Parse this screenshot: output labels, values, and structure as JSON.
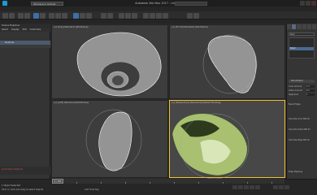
{
  "window": {
    "title": "Autodesk 3ds Max 2017 - Untitled",
    "workspace": "Workspace: Default"
  },
  "left_panel": {
    "title": "Scene Explorer",
    "tabs": [
      "Select",
      "Display",
      "Edit",
      "Customize"
    ],
    "selected_item": "Sinkhole"
  },
  "viewports": [
    {
      "label": "[+] [Top] [Standard] [Wireframe]"
    },
    {
      "label": "[+] [Front] [Standard] [Wireframe]"
    },
    {
      "label": "[+] [Left] [Standard] [Wireframe]"
    },
    {
      "label": "[+] [Perspective] [Standard] [Default Shading]"
    }
  ],
  "right_panel": {
    "object_name": "Sink",
    "selected_modifier": "Shell",
    "rollout": "Parameters",
    "params": [
      {
        "label": "Inner Amount",
        "value": "1.0"
      },
      {
        "label": "Outer Amount",
        "value": "0.0"
      },
      {
        "label": "Segments",
        "value": "1"
      }
    ],
    "bevel_label": "Bevel Edges",
    "override_rows": [
      "Override Inner Mat ID",
      "Override Outer Mat ID",
      "Override Edge Mat ID"
    ],
    "bottom_label": "Edge Mapping"
  },
  "timeline": {
    "frame": "0 / 100"
  },
  "status": {
    "context": "Autodesk Default",
    "prompt": "Click or click-and-drag to select objects",
    "sel": "1 Object Selected",
    "addtime": "Add Time Tag"
  },
  "colors": {
    "active_viewport": "#f0c030",
    "selection": "#4b6b8f",
    "shaded_object": "#a8c070",
    "wire": "#ffffff"
  }
}
